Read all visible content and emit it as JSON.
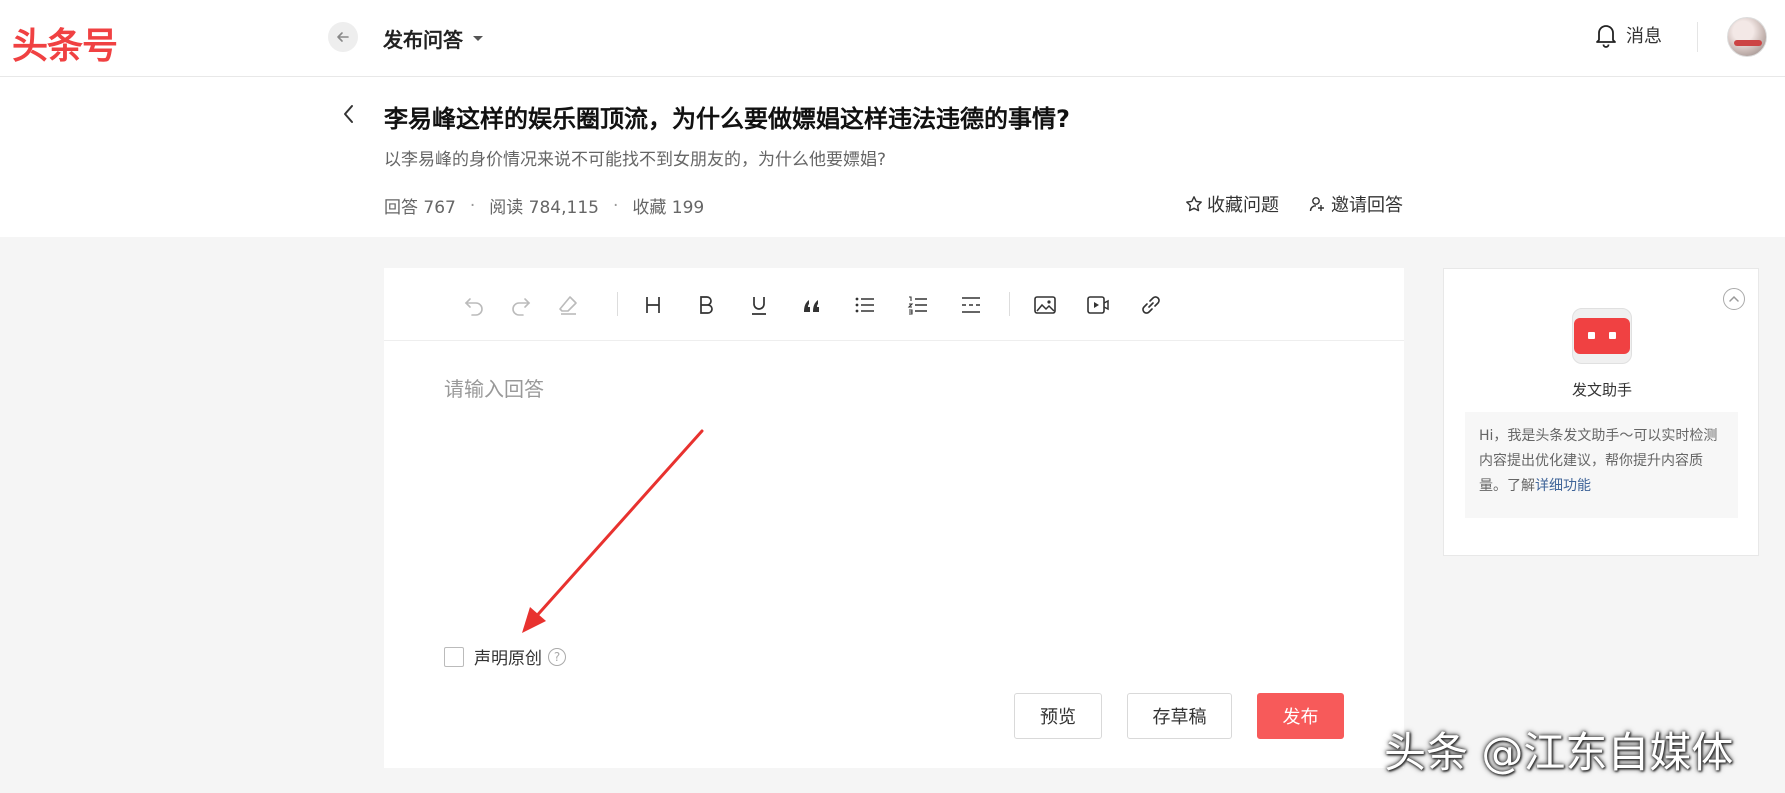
{
  "header": {
    "logo": "头条号",
    "page_mode": "发布问答",
    "messages_label": "消息"
  },
  "question": {
    "title": "李易峰这样的娱乐圈顶流，为什么要做嫖娼这样违法违德的事情?",
    "description": "以李易峰的身价情况来说不可能找不到女朋友的，为什么他要嫖娼?",
    "stats": {
      "answers": "回答 767",
      "reads": "阅读 784,115",
      "favorites": "收藏 199",
      "separator": "·"
    },
    "actions": {
      "favorite": "收藏问题",
      "invite": "邀请回答"
    }
  },
  "editor": {
    "toolbar_icons": [
      "undo-icon",
      "redo-icon",
      "eraser-icon",
      "heading-icon",
      "bold-icon",
      "underline-icon",
      "quote-icon",
      "bullet-list-icon",
      "ordered-list-icon",
      "divider-icon",
      "image-icon",
      "video-icon",
      "link-icon"
    ],
    "placeholder": "请输入回答",
    "original_label": "声明原创",
    "help_mark": "?",
    "buttons": {
      "preview": "预览",
      "draft": "存草稿",
      "publish": "发布"
    }
  },
  "assistant": {
    "name": "发文助手",
    "tip_text": "Hi，我是头条发文助手～可以实时检测内容提出优化建议，帮你提升内容质量。了解",
    "tip_link": "详细功能"
  },
  "watermark": "头条 @江东自媒体",
  "colors": {
    "brand_red": "#f04142",
    "publish_button": "#f75a5a",
    "link_blue": "#406599",
    "annotation_arrow": "#e8322f"
  }
}
